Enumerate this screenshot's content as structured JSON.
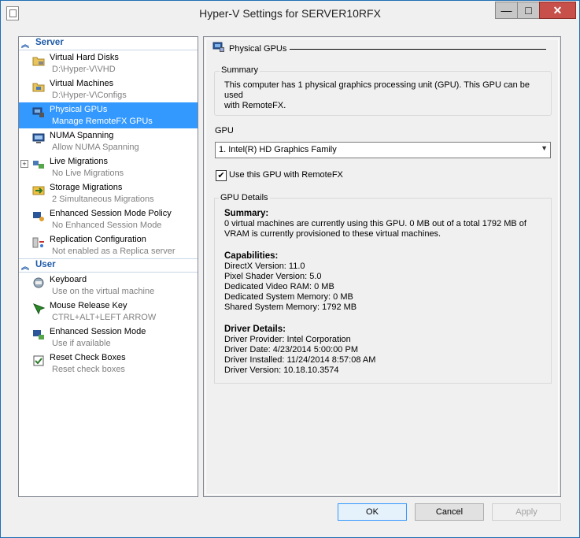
{
  "window": {
    "title": "Hyper-V Settings for SERVER10RFX",
    "minimize_glyph": "—",
    "maximize_glyph": "□",
    "close_glyph": "✕"
  },
  "sidebar": {
    "categories": [
      {
        "label": "Server",
        "items": [
          {
            "name": "Virtual Hard Disks",
            "sub": "D:\\Hyper-V\\VHD",
            "icon": "folder-disk-icon"
          },
          {
            "name": "Virtual Machines",
            "sub": "D:\\Hyper-V\\Configs",
            "icon": "folder-vm-icon"
          },
          {
            "name": "Physical GPUs",
            "sub": "Manage RemoteFX GPUs",
            "icon": "gpu-icon",
            "selected": true
          },
          {
            "name": "NUMA Spanning",
            "sub": "Allow NUMA Spanning",
            "icon": "numa-icon"
          },
          {
            "name": "Live Migrations",
            "sub": "No Live Migrations",
            "icon": "migration-icon",
            "expandable": true
          },
          {
            "name": "Storage Migrations",
            "sub": "2 Simultaneous Migrations",
            "icon": "storage-migration-icon"
          },
          {
            "name": "Enhanced Session Mode Policy",
            "sub": "No Enhanced Session Mode",
            "icon": "session-policy-icon"
          },
          {
            "name": "Replication Configuration",
            "sub": "Not enabled as a Replica server",
            "icon": "replication-icon"
          }
        ]
      },
      {
        "label": "User",
        "items": [
          {
            "name": "Keyboard",
            "sub": "Use on the virtual machine",
            "icon": "keyboard-icon"
          },
          {
            "name": "Mouse Release Key",
            "sub": "CTRL+ALT+LEFT ARROW",
            "icon": "mouse-key-icon"
          },
          {
            "name": "Enhanced Session Mode",
            "sub": "Use if available",
            "icon": "session-mode-icon"
          },
          {
            "name": "Reset Check Boxes",
            "sub": "Reset check boxes",
            "icon": "reset-checkbox-icon"
          }
        ]
      }
    ]
  },
  "main": {
    "section_title": "Physical GPUs",
    "summary": {
      "label": "Summary",
      "text": "This computer has 1 physical graphics processing unit (GPU). This GPU can be used\nwith RemoteFX."
    },
    "gpu": {
      "label": "GPU",
      "selected": "1. Intel(R) HD Graphics Family"
    },
    "checkbox": {
      "label": "Use this GPU with RemoteFX",
      "checked": true
    },
    "details": {
      "label": "GPU Details",
      "summary_head": "Summary:",
      "summary_text": "0 virtual machines are currently using this GPU. 0 MB out of a total 1792 MB of\nVRAM is currently provisioned to these virtual machines.",
      "capabilities_head": "Capabilities:",
      "capabilities": [
        "DirectX Version: 11.0",
        "Pixel Shader Version: 5.0",
        "Dedicated Video RAM: 0 MB",
        "Dedicated System Memory: 0 MB",
        "Shared System Memory: 1792 MB"
      ],
      "driver_head": "Driver Details:",
      "driver": [
        "Driver Provider: Intel Corporation",
        "Driver Date: 4/23/2014 5:00:00 PM",
        "Driver Installed: 11/24/2014 8:57:08 AM",
        "Driver Version: 10.18.10.3574"
      ]
    }
  },
  "buttons": {
    "ok": "OK",
    "cancel": "Cancel",
    "apply": "Apply"
  }
}
